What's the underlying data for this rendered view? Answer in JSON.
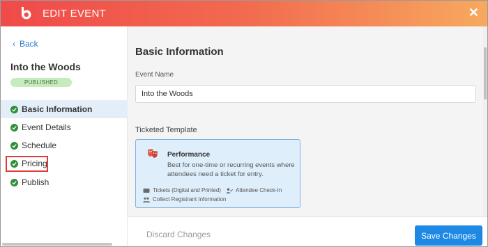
{
  "header": {
    "title": "EDIT EVENT",
    "close_label": "✕"
  },
  "sidebar": {
    "back_label": "Back",
    "event_title": "Into the Woods",
    "status": "PUBLISHED",
    "items": [
      {
        "label": "Basic Information"
      },
      {
        "label": "Event Details"
      },
      {
        "label": "Schedule"
      },
      {
        "label": "Pricing"
      },
      {
        "label": "Publish"
      }
    ]
  },
  "main": {
    "section_title": "Basic Information",
    "event_name_label": "Event Name",
    "event_name_value": "Into the Woods",
    "template_label": "Ticketed Template",
    "template_card": {
      "title": "Performance",
      "description": "Best for one-time or recurring events where attendees need a ticket for entry.",
      "features": [
        "Tickets (Digital and Printed)",
        "Attendee Check-In",
        "Collect Registrant Information"
      ]
    }
  },
  "footer": {
    "discard_label": "Discard Changes",
    "save_label": "Save Changes"
  },
  "colors": {
    "accent": "#1e88e5",
    "check": "#2f8f3a",
    "header_start": "#f04a4a",
    "header_end": "#f7a95f",
    "highlight": "#e23a3a"
  }
}
